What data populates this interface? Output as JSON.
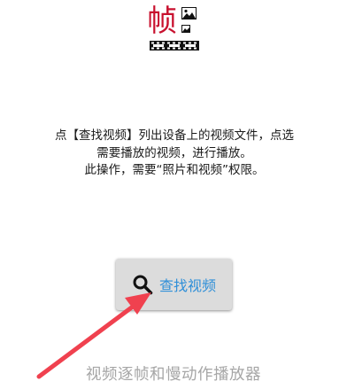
{
  "logo": {
    "char": "帧",
    "icon_name": "frame-logo",
    "accent_color": "#c8102e"
  },
  "instructions": {
    "line1": "点【查找视频】列出设备上的视频文件，点选需要播放的视频，进行播放。",
    "line2": "此操作，需要“照片和视频”权限。"
  },
  "search_button": {
    "label": "查找视频",
    "icon": "search-icon",
    "label_color": "#2f8fd8"
  },
  "app_subtitle": "视频逐帧和慢动作播放器",
  "annotation": {
    "icon": "red-arrow",
    "color": "#f0414f"
  }
}
